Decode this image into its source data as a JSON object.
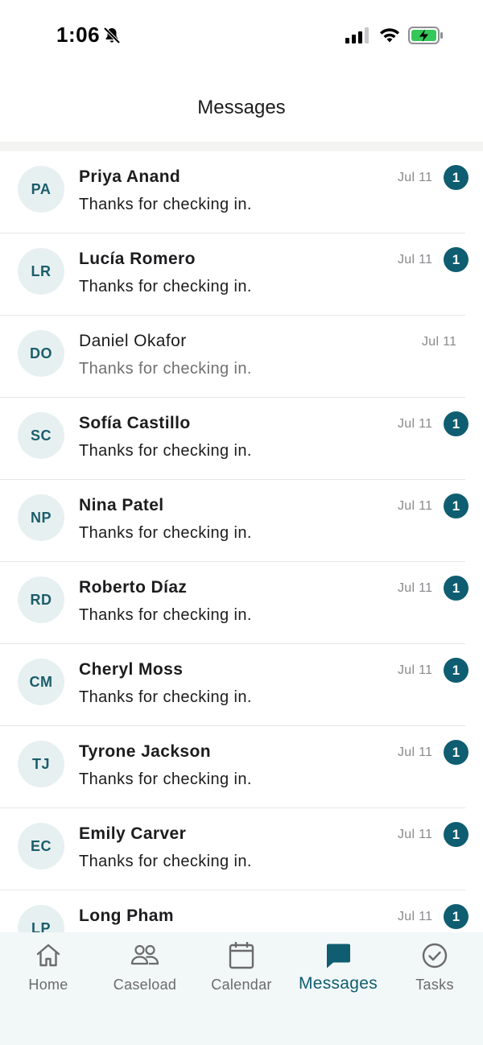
{
  "status_bar": {
    "time": "1:06",
    "icons": [
      "bell-slash-icon",
      "signal-icon",
      "wifi-icon",
      "battery-charging-icon"
    ]
  },
  "header": {
    "title": "Messages"
  },
  "colors": {
    "accent": "#0f5d70",
    "avatar_bg": "#e7f0f1",
    "tab_bar_bg": "#f2f7f8",
    "battery_green": "#34c759"
  },
  "messages": [
    {
      "initials": "PA",
      "name": "Priya Anand",
      "preview": "Thanks for checking in.",
      "date": "Jul 11",
      "unread": "1"
    },
    {
      "initials": "LR",
      "name": "Lucía Romero",
      "preview": "Thanks for checking in.",
      "date": "Jul 11",
      "unread": "1"
    },
    {
      "initials": "DO",
      "name": "Daniel Okafor",
      "preview": "Thanks for checking in.",
      "date": "Jul 11",
      "unread": ""
    },
    {
      "initials": "SC",
      "name": "Sofía Castillo",
      "preview": "Thanks for checking in.",
      "date": "Jul 11",
      "unread": "1"
    },
    {
      "initials": "NP",
      "name": "Nina Patel",
      "preview": "Thanks for checking in.",
      "date": "Jul 11",
      "unread": "1"
    },
    {
      "initials": "RD",
      "name": "Roberto Díaz",
      "preview": "Thanks for checking in.",
      "date": "Jul 11",
      "unread": "1"
    },
    {
      "initials": "CM",
      "name": "Cheryl Moss",
      "preview": "Thanks for checking in.",
      "date": "Jul 11",
      "unread": "1"
    },
    {
      "initials": "TJ",
      "name": "Tyrone Jackson",
      "preview": "Thanks for checking in.",
      "date": "Jul 11",
      "unread": "1"
    },
    {
      "initials": "EC",
      "name": "Emily Carver",
      "preview": "Thanks for checking in.",
      "date": "Jul 11",
      "unread": "1"
    },
    {
      "initials": "LP",
      "name": "Long Pham",
      "preview": "",
      "date": "Jul 11",
      "unread": "1"
    }
  ],
  "tab_bar": {
    "tabs": [
      {
        "label": "Home",
        "icon": "home-icon",
        "active": false
      },
      {
        "label": "Caseload",
        "icon": "people-icon",
        "active": false
      },
      {
        "label": "Calendar",
        "icon": "calendar-icon",
        "active": false
      },
      {
        "label": "Messages",
        "icon": "chat-bubble-icon",
        "active": true
      },
      {
        "label": "Tasks",
        "icon": "check-circle-icon",
        "active": false
      }
    ]
  }
}
